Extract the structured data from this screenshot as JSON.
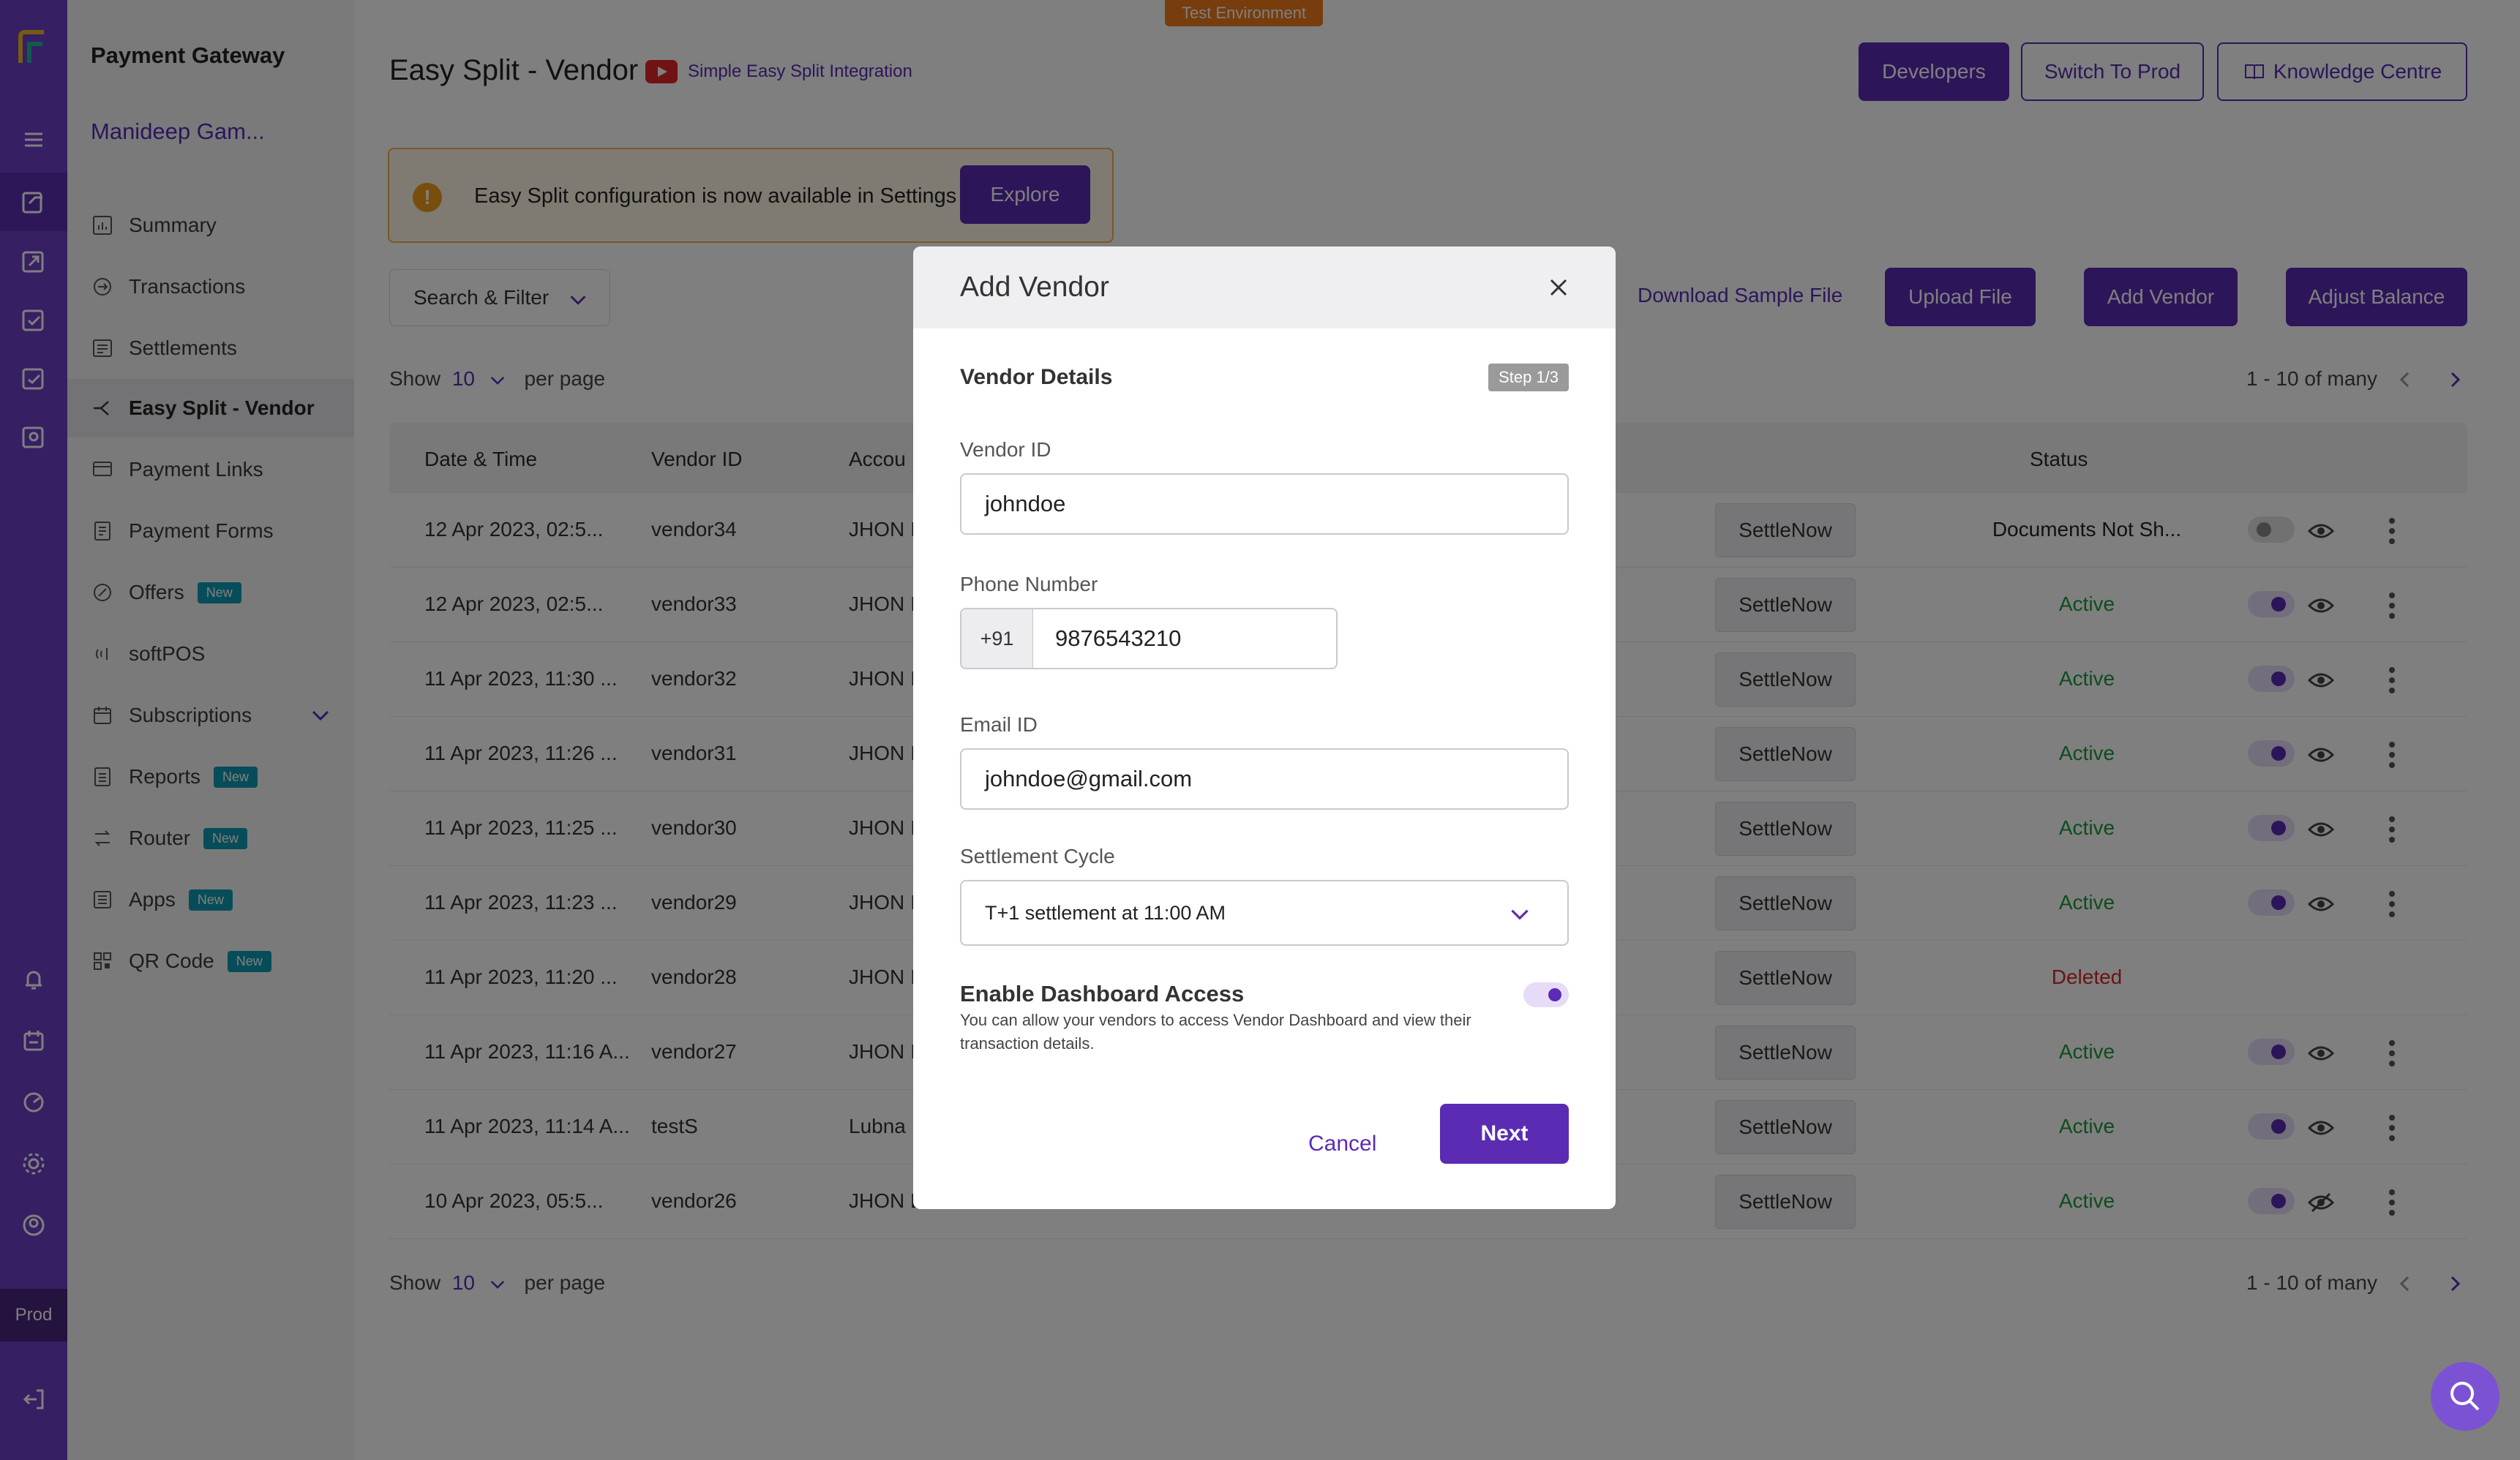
{
  "env_badge": "Test Environment",
  "rail": {
    "prod_label": "Prod",
    "icons": [
      "logo-icon",
      "hamburger-menu-icon",
      "payment-gateway-icon",
      "payouts-icon",
      "verification-icon",
      "subscriptions-icon",
      "invoices-icon",
      "bell-icon",
      "calendar-icon",
      "analytics-icon",
      "gear-icon",
      "user-circle-icon",
      "logout-icon"
    ]
  },
  "sidebar": {
    "brand": "Payment Gateway",
    "merchant": "Manideep Gam...",
    "items": [
      {
        "label": "Summary",
        "icon": "bar-chart-icon",
        "badge": ""
      },
      {
        "label": "Transactions",
        "icon": "refresh-icon",
        "badge": ""
      },
      {
        "label": "Settlements",
        "icon": "ledger-icon",
        "badge": ""
      },
      {
        "label": "Easy Split - Vendor",
        "icon": "split-icon",
        "badge": "",
        "active": true
      },
      {
        "label": "Payment Links",
        "icon": "link-card-icon",
        "badge": ""
      },
      {
        "label": "Payment Forms",
        "icon": "form-icon",
        "badge": ""
      },
      {
        "label": "Offers",
        "icon": "percent-badge-icon",
        "badge": "New"
      },
      {
        "label": "softPOS",
        "icon": "wireless-icon",
        "badge": ""
      },
      {
        "label": "Subscriptions",
        "icon": "calendar-icon",
        "badge": ""
      },
      {
        "label": "Reports",
        "icon": "document-icon",
        "badge": "New"
      },
      {
        "label": "Router",
        "icon": "router-icon",
        "badge": "New"
      },
      {
        "label": "Apps",
        "icon": "apps-icon",
        "badge": "New"
      },
      {
        "label": "QR Code",
        "icon": "qr-code-icon",
        "badge": "New"
      }
    ]
  },
  "header": {
    "title": "Easy Split - Vendor",
    "video_link": "Simple Easy Split Integration",
    "developers": "Developers",
    "switch_prod": "Switch To Prod",
    "knowledge": "Knowledge Centre"
  },
  "banner": {
    "text": "Easy Split configuration is now available in Settings",
    "button": "Explore"
  },
  "toolbar": {
    "search_filter": "Search & Filter",
    "download_sample": "Download Sample File",
    "upload_file": "Upload File",
    "add_vendor": "Add Vendor",
    "adjust_balance": "Adjust Balance"
  },
  "pagination": {
    "show": "Show",
    "per_page_value": "10",
    "per_page": "per page",
    "range": "1 - 10 of many"
  },
  "table": {
    "headers": {
      "date_time": "Date & Time",
      "vendor_id": "Vendor ID",
      "account": "Accou",
      "status": "Status"
    },
    "settle_label": "SettleNow",
    "rows": [
      {
        "date": "12 Apr 2023, 02:5...",
        "vendor": "vendor34",
        "account": "JHON I",
        "status": "Documents Not Sh...",
        "status_color": "#222222",
        "toggle": "off",
        "eye": "eye-icon"
      },
      {
        "date": "12 Apr 2023, 02:5...",
        "vendor": "vendor33",
        "account": "JHON I",
        "status": "Active",
        "status_color": "#1a9a3a",
        "toggle": "on",
        "eye": "eye-icon"
      },
      {
        "date": "11 Apr 2023, 11:30 ...",
        "vendor": "vendor32",
        "account": "JHON I",
        "status": "Active",
        "status_color": "#1a9a3a",
        "toggle": "on",
        "eye": "eye-icon"
      },
      {
        "date": "11 Apr 2023, 11:26 ...",
        "vendor": "vendor31",
        "account": "JHON I",
        "status": "Active",
        "status_color": "#1a9a3a",
        "toggle": "on",
        "eye": "eye-icon"
      },
      {
        "date": "11 Apr 2023, 11:25 ...",
        "vendor": "vendor30",
        "account": "JHON I",
        "status": "Active",
        "status_color": "#1a9a3a",
        "toggle": "on",
        "eye": "eye-icon"
      },
      {
        "date": "11 Apr 2023, 11:23 ...",
        "vendor": "vendor29",
        "account": "JHON I",
        "status": "Active",
        "status_color": "#1a9a3a",
        "toggle": "on",
        "eye": "eye-icon"
      },
      {
        "date": "11 Apr 2023, 11:20 ...",
        "vendor": "vendor28",
        "account": "JHON I",
        "status": "Deleted",
        "status_color": "#d6262b",
        "toggle": "none",
        "eye": "none"
      },
      {
        "date": "11 Apr 2023, 11:16 A...",
        "vendor": "vendor27",
        "account": "JHON I",
        "status": "Active",
        "status_color": "#1a9a3a",
        "toggle": "on",
        "eye": "eye-icon"
      },
      {
        "date": "11 Apr 2023, 11:14 A...",
        "vendor": "testS",
        "account": "Lubna",
        "status": "Active",
        "status_color": "#1a9a3a",
        "toggle": "on",
        "eye": "eye-icon"
      },
      {
        "date": "10 Apr 2023, 05:5...",
        "vendor": "vendor26",
        "account": "JHON DOE",
        "status": "Active",
        "status_color": "#1a9a3a",
        "toggle": "on",
        "eye": "eye-off-icon"
      }
    ]
  },
  "modal": {
    "title": "Add Vendor",
    "section": "Vendor Details",
    "step": "Step 1/3",
    "vendor_id_label": "Vendor ID",
    "vendor_id_value": "johndoe",
    "phone_label": "Phone Number",
    "phone_code": "+91",
    "phone_value": "9876543210",
    "email_label": "Email ID",
    "email_value": "johndoe@gmail.com",
    "cycle_label": "Settlement Cycle",
    "cycle_value": "T+1 settlement at 11:00 AM",
    "dashboard_title": "Enable Dashboard Access",
    "dashboard_desc": "You can allow your vendors to access Vendor Dashboard and view their transaction details.",
    "cancel": "Cancel",
    "next": "Next"
  },
  "colors": {
    "brand": "#5b2bb4",
    "rail": "#6c3fc6",
    "active_status": "#1a9a3a",
    "deleted_status": "#d6262b"
  }
}
